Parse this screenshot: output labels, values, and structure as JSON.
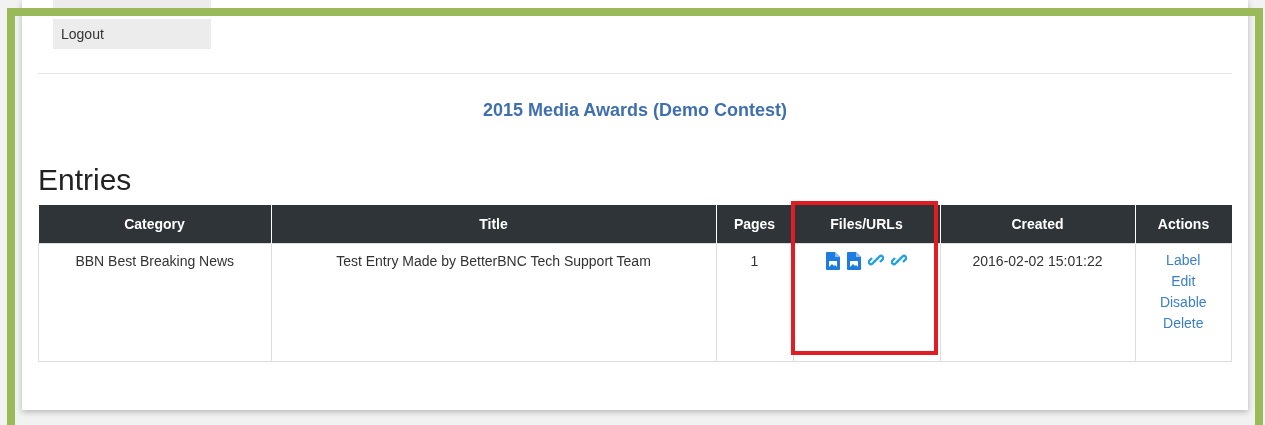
{
  "menu": [
    {
      "label": "Logout"
    }
  ],
  "contest_title": "2015 Media Awards (Demo Contest)",
  "heading": "Entries",
  "table": {
    "columns": [
      {
        "label": "Category",
        "highlighted": false
      },
      {
        "label": "Title",
        "highlighted": false
      },
      {
        "label": "Pages",
        "highlighted": false
      },
      {
        "label": "Files/URLs",
        "highlighted": true
      },
      {
        "label": "Created",
        "highlighted": false
      },
      {
        "label": "Actions",
        "highlighted": false
      }
    ],
    "rows": [
      {
        "category": "BBN Best Breaking News",
        "title": "Test Entry Made by BetterBNC Tech Support Team",
        "pages": "1",
        "files": [
          {
            "kind": "file"
          },
          {
            "kind": "file"
          },
          {
            "kind": "link"
          },
          {
            "kind": "link"
          }
        ],
        "created": "2016-02-02 15:01:22",
        "actions": [
          "Label",
          "Edit",
          "Disable",
          "Delete"
        ]
      }
    ]
  }
}
